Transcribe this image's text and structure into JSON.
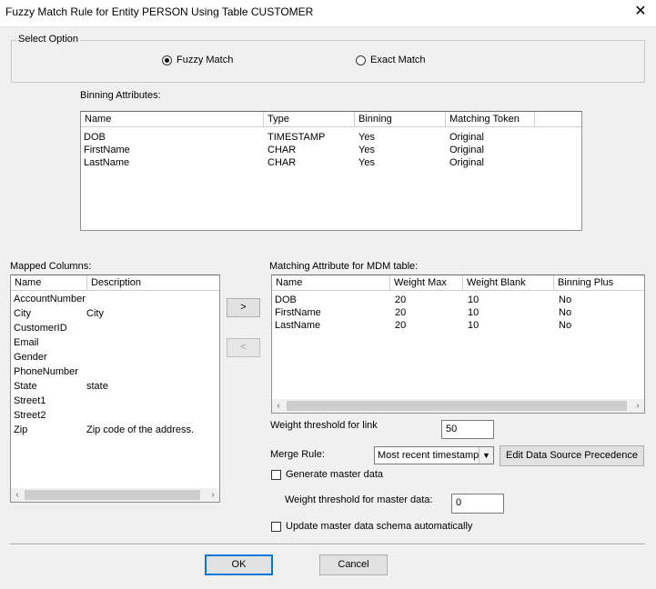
{
  "window": {
    "title": "Fuzzy Match Rule for Entity PERSON Using Table CUSTOMER",
    "close_glyph": "✕"
  },
  "select_option": {
    "legend": "Select Option",
    "fuzzy_label": "Fuzzy Match",
    "exact_label": "Exact Match",
    "selected": "Fuzzy Match"
  },
  "binning": {
    "label": "Binning Attributes:",
    "headers": [
      "Name",
      "Type",
      "Binning",
      "Matching Token"
    ],
    "rows": [
      [
        "DOB",
        "TIMESTAMP",
        "Yes",
        "Original"
      ],
      [
        "FirstName",
        "CHAR",
        "Yes",
        "Original"
      ],
      [
        "LastName",
        "CHAR",
        "Yes",
        "Original"
      ]
    ]
  },
  "mapped": {
    "label": "Mapped Columns:",
    "headers": [
      "Name",
      "Description"
    ],
    "rows": [
      [
        "AccountNumber",
        ""
      ],
      [
        "City",
        "City"
      ],
      [
        "CustomerID",
        ""
      ],
      [
        "Email",
        ""
      ],
      [
        "Gender",
        ""
      ],
      [
        "PhoneNumber",
        ""
      ],
      [
        "State",
        "state"
      ],
      [
        "Street1",
        ""
      ],
      [
        "Street2",
        ""
      ],
      [
        "Zip",
        "Zip code of the address."
      ]
    ]
  },
  "move": {
    "add_label": ">",
    "remove_label": "<"
  },
  "matching": {
    "label": "Matching Attribute for MDM table:",
    "headers": [
      "Name",
      "Weight Max",
      "Weight Blank",
      "Binning Plus"
    ],
    "rows": [
      [
        "DOB",
        "20",
        "10",
        "No"
      ],
      [
        "FirstName",
        "20",
        "10",
        "No"
      ],
      [
        "LastName",
        "20",
        "10",
        "No"
      ]
    ]
  },
  "scroll": {
    "left_glyph": "‹",
    "right_glyph": "›"
  },
  "link_threshold": {
    "label": "Weight threshold for link",
    "value": "50"
  },
  "merge_rule": {
    "label": "Merge Rule:",
    "value": "Most recent timestamp",
    "drop_glyph": "▼"
  },
  "edit_precedence_label": "Edit Data Source Precedence",
  "generate_master": {
    "label": "Generate master data",
    "checked": false
  },
  "master_threshold": {
    "label": "Weight threshold for master data:",
    "value": "0"
  },
  "update_schema": {
    "label": "Update master data schema automatically",
    "checked": false
  },
  "footer": {
    "ok_label": "OK",
    "cancel_label": "Cancel"
  }
}
